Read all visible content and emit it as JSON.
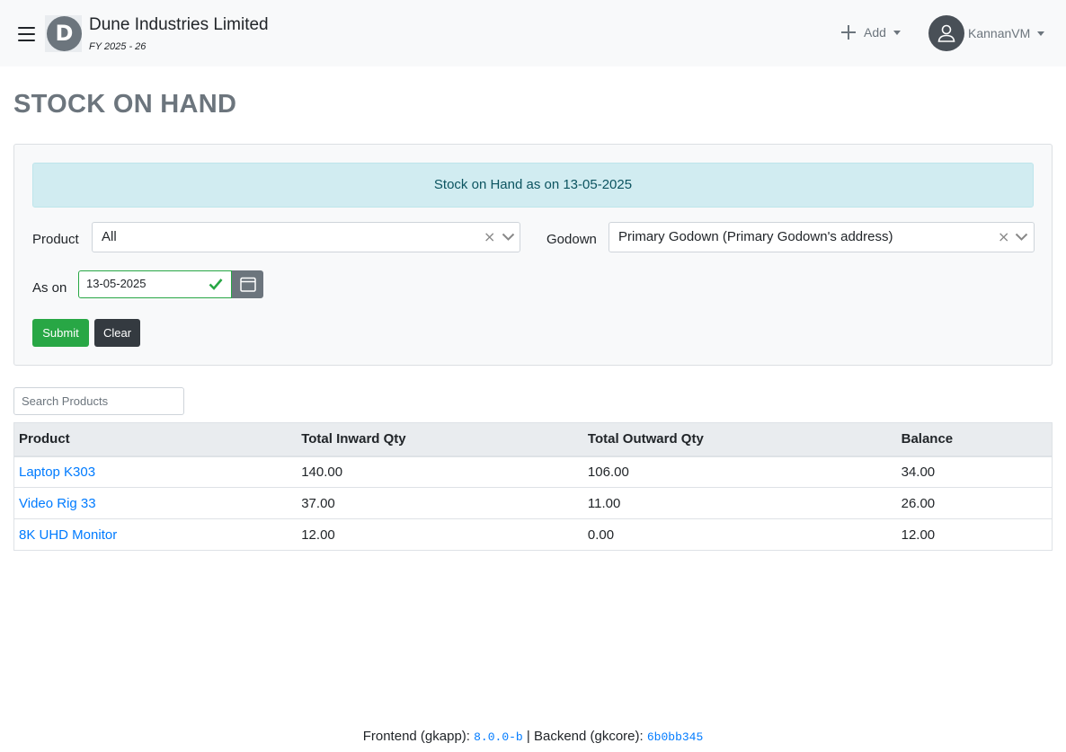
{
  "navbar": {
    "menu_icon": "hamburger-menu-icon",
    "logo_letter": "D",
    "org_name": "Dune Industries Limited",
    "financial_year": "FY 2025 - 26",
    "add_label": "Add",
    "add_icon": "plus-icon",
    "user_icon": "user-icon",
    "user_name": "KannanVM"
  },
  "page": {
    "title": "STOCK ON HAND"
  },
  "filters": {
    "alert_text": "Stock on Hand as on 13-05-2025",
    "product_label": "Product",
    "product_value": "All",
    "godown_label": "Godown",
    "godown_value": "Primary Godown (Primary Godown's address)",
    "as_on_label": "As on",
    "as_on_value": "13-05-2025",
    "calendar_icon": "calendar-icon",
    "valid_icon": "checkmark-icon",
    "submit_label": "Submit",
    "clear_label": "Clear"
  },
  "search": {
    "placeholder": "Search Products"
  },
  "table": {
    "headers": [
      "Product",
      "Total Inward Qty",
      "Total Outward Qty",
      "Balance"
    ],
    "rows": [
      [
        "Laptop K303",
        "140.00",
        "106.00",
        "34.00"
      ],
      [
        "Video Rig 33",
        "37.00",
        "11.00",
        "26.00"
      ],
      [
        "8K UHD Monitor",
        "12.00",
        "0.00",
        "12.00"
      ]
    ]
  },
  "footer": {
    "frontend_label": "Frontend (gkapp): ",
    "frontend_version": "8.0.0-b",
    "separator": " | Backend (gkcore): ",
    "backend_version": "6b0bb345"
  },
  "colors": {
    "primary": "#007bff",
    "success": "#28a745",
    "dark": "#343a40",
    "info_bg": "#d1ecf1"
  }
}
